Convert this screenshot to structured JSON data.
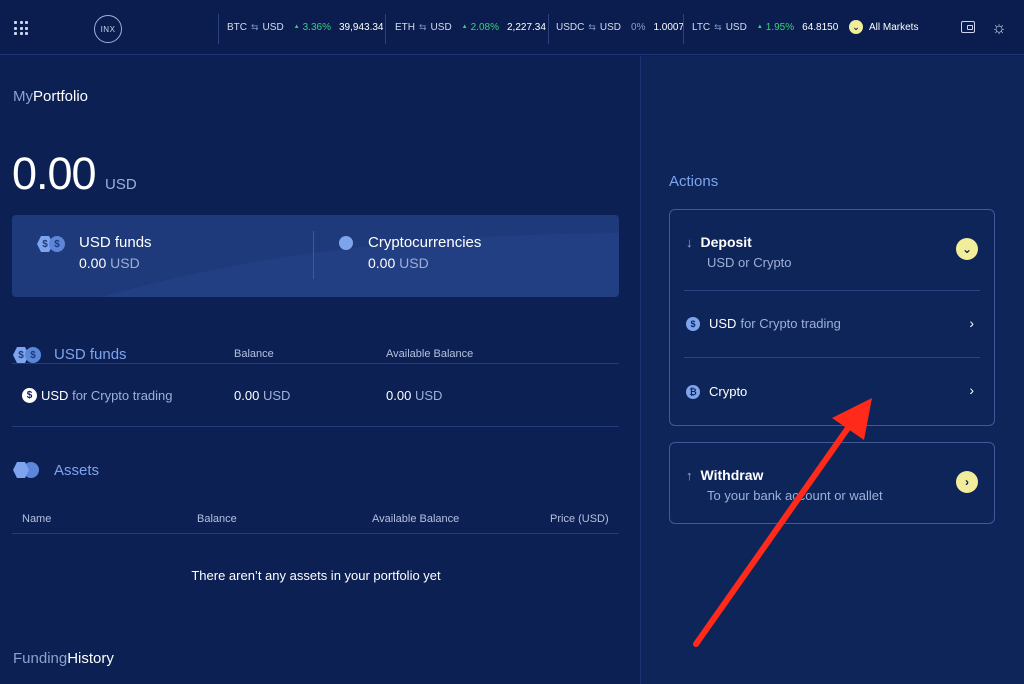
{
  "topbar": {
    "logo_text": "INX",
    "tickers": [
      {
        "base": "BTC",
        "quote": "USD",
        "change": "3.36%",
        "price": "39,943.34"
      },
      {
        "base": "ETH",
        "quote": "USD",
        "change": "2.08%",
        "price": "2,227.34"
      },
      {
        "base": "USDC",
        "quote": "USD",
        "change": "0%",
        "price": "1.0007"
      },
      {
        "base": "LTC",
        "quote": "USD",
        "change": "1.95%",
        "price": "64.8150"
      }
    ],
    "all_markets": "All Markets"
  },
  "portfolio": {
    "title_light": "My",
    "title_bold": "Portfolio",
    "balance": "0.00",
    "balance_unit": "USD",
    "summary": {
      "usd_funds_label": "USD funds",
      "usd_funds_value": "0.00",
      "usd_funds_unit": "USD",
      "crypto_label": "Cryptocurrencies",
      "crypto_value": "0.00",
      "crypto_unit": "USD"
    }
  },
  "usd_funds_section": {
    "title": "USD funds",
    "col_balance": "Balance",
    "col_available": "Available Balance",
    "row": {
      "name_bold": "USD",
      "name_rest": "for Crypto trading",
      "balance": "0.00",
      "balance_unit": "USD",
      "available": "0.00",
      "available_unit": "USD"
    }
  },
  "assets_section": {
    "title": "Assets",
    "columns": [
      "Name",
      "Balance",
      "Available Balance",
      "Price (USD)"
    ],
    "empty_message": "There aren’t any assets in your portfolio yet"
  },
  "funding_history": {
    "title_light": "Funding",
    "title_bold": "History"
  },
  "actions": {
    "title": "Actions",
    "deposit": {
      "label": "Deposit",
      "sub": "USD or Crypto",
      "options": [
        {
          "bold": "USD",
          "rest": "for Crypto trading"
        },
        {
          "bold": "Crypto",
          "rest": ""
        }
      ]
    },
    "withdraw": {
      "label": "Withdraw",
      "sub": "To your bank account or wallet"
    }
  },
  "colors": {
    "background": "#0b1f52",
    "accent_blue": "#7ea4ee",
    "positive_green": "#38d27c",
    "highlight_yellow": "#f2ed9a",
    "annotation_red": "#ff2a1a"
  }
}
